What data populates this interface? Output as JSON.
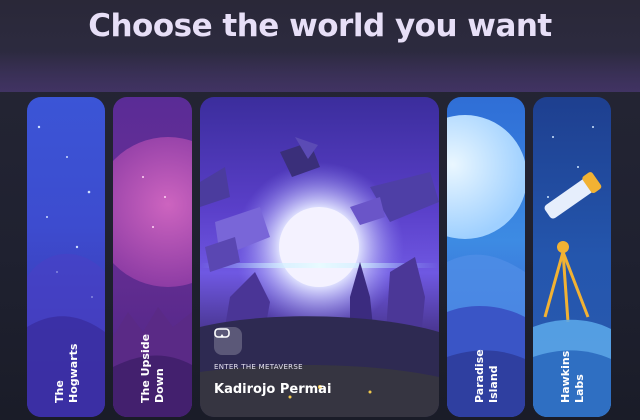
{
  "page": {
    "title": "Choose the world you want"
  },
  "worlds": [
    {
      "label": "The\nHogwarts"
    },
    {
      "label": "The Upside\nDown"
    },
    {
      "featured_caption": "ENTER THE METAVERSE",
      "name": "Kadirojo Permai"
    },
    {
      "label": "Paradise\nIsland"
    },
    {
      "label": "Hawkins\nLabs"
    }
  ],
  "icons": {
    "vr": "vr-headset-icon"
  }
}
